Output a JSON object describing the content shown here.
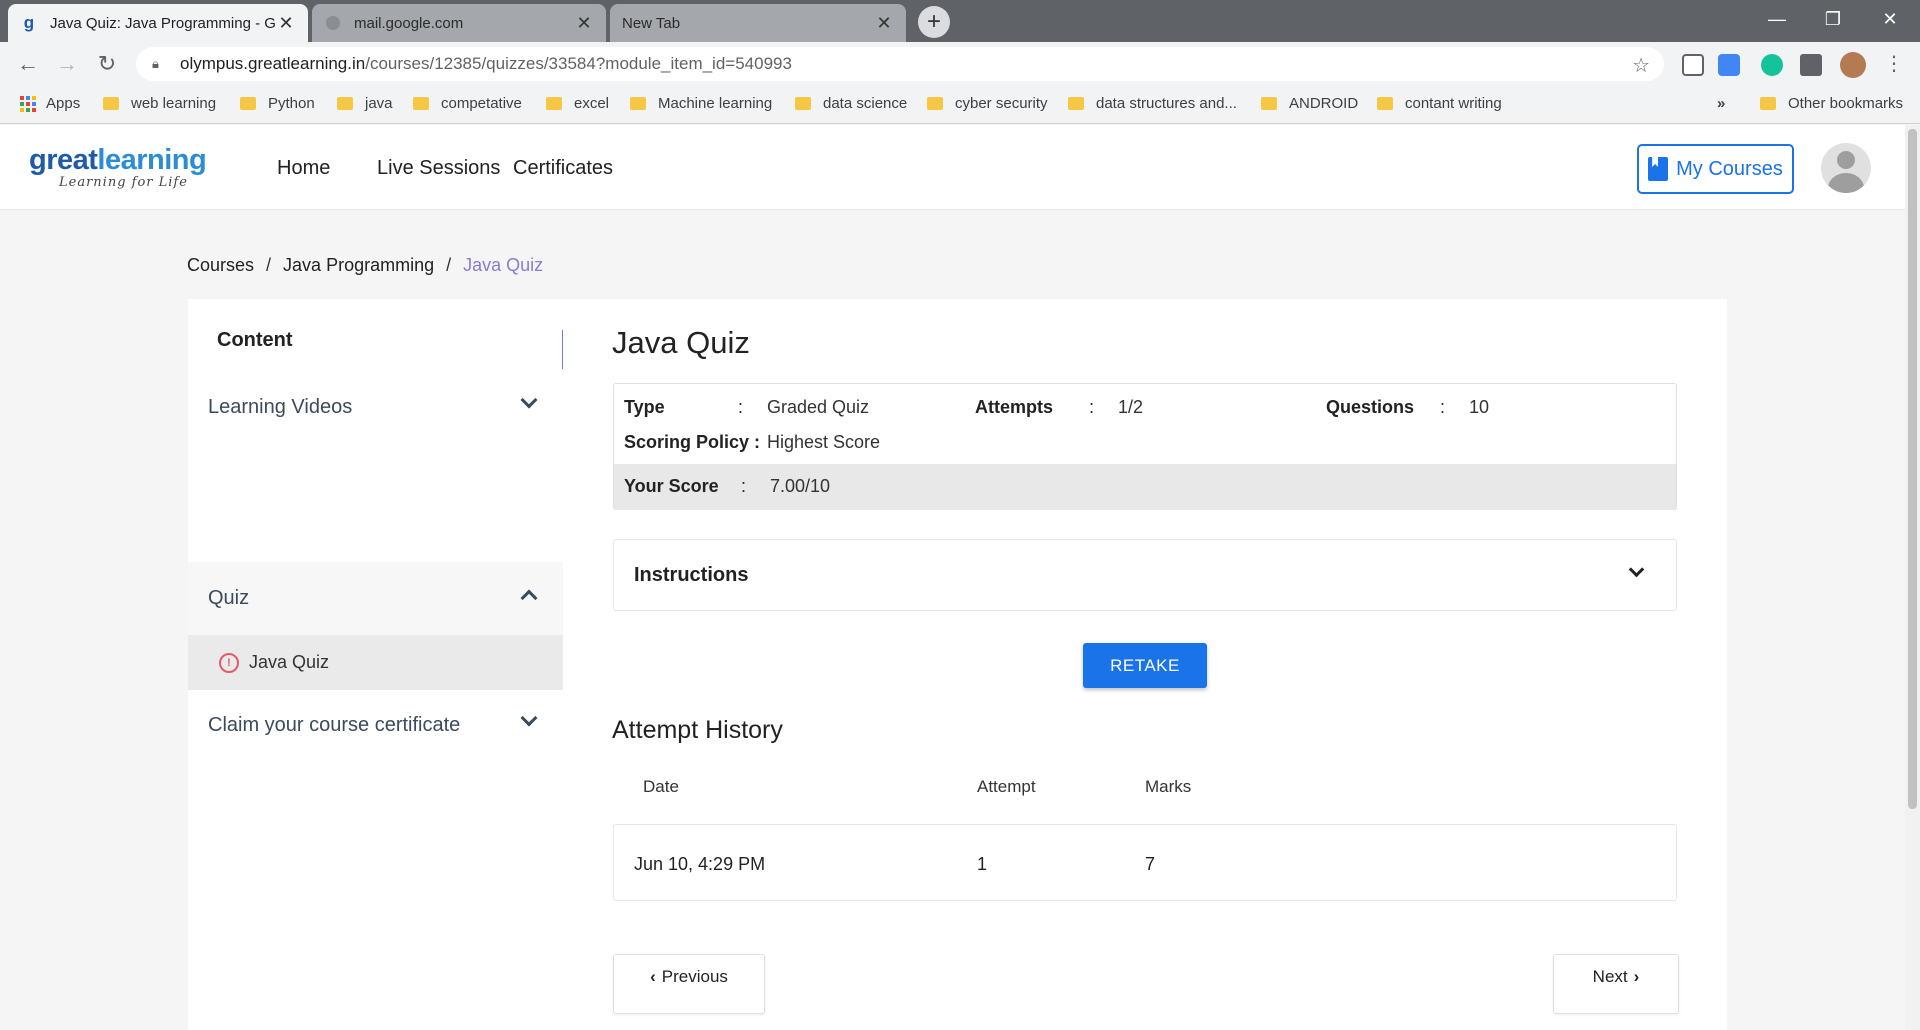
{
  "browser": {
    "tabs": [
      {
        "title": "Java Quiz: Java Programming - Gr",
        "favicon": "gl"
      },
      {
        "title": "mail.google.com",
        "favicon": "globe"
      },
      {
        "title": "New Tab",
        "favicon": ""
      }
    ],
    "url_host": "olympus.greatlearning.in",
    "url_path": "/courses/12385/quizzes/33584?module_item_id=540993",
    "bookmarks": [
      "Apps",
      "web learning",
      "Python",
      "java",
      "competative",
      "excel",
      "Machine learning",
      "data science",
      "cyber security",
      "data structures and...",
      "ANDROID",
      "contant writing"
    ],
    "overflow": "»",
    "other_bookmarks": "Other bookmarks"
  },
  "site": {
    "logo_main_a": "great",
    "logo_main_b": "learning",
    "logo_tagline": "Learning for Life",
    "nav": [
      "Home",
      "Live Sessions",
      "Certificates"
    ],
    "my_courses": "My Courses",
    "brand_color": "#1a73e8"
  },
  "breadcrumb": [
    "Courses",
    "Java Programming",
    "Java Quiz"
  ],
  "sidebar": {
    "title": "Content",
    "sections": [
      {
        "label": "Learning Videos",
        "expanded": false
      },
      {
        "label": "Quiz",
        "expanded": true
      },
      {
        "label": "Claim your course certificate",
        "expanded": false
      }
    ],
    "quiz_item": "Java Quiz"
  },
  "quiz": {
    "title": "Java Quiz",
    "type_label": "Type",
    "type_value": "Graded Quiz",
    "attempts_label": "Attempts",
    "attempts_value": "1/2",
    "questions_label": "Questions",
    "questions_value": "10",
    "policy_label": "Scoring Policy :",
    "policy_value": "Highest Score",
    "score_label": "Your Score",
    "score_value": "7.00/10",
    "colon": ":",
    "instructions": "Instructions",
    "retake": "RETAKE"
  },
  "history": {
    "title": "Attempt History",
    "columns": [
      "Date",
      "Attempt",
      "Marks"
    ],
    "rows": [
      {
        "date": "Jun 10, 4:29 PM",
        "attempt": "1",
        "marks": "7"
      }
    ]
  },
  "pager": {
    "previous": "Previous",
    "next": "Next"
  }
}
